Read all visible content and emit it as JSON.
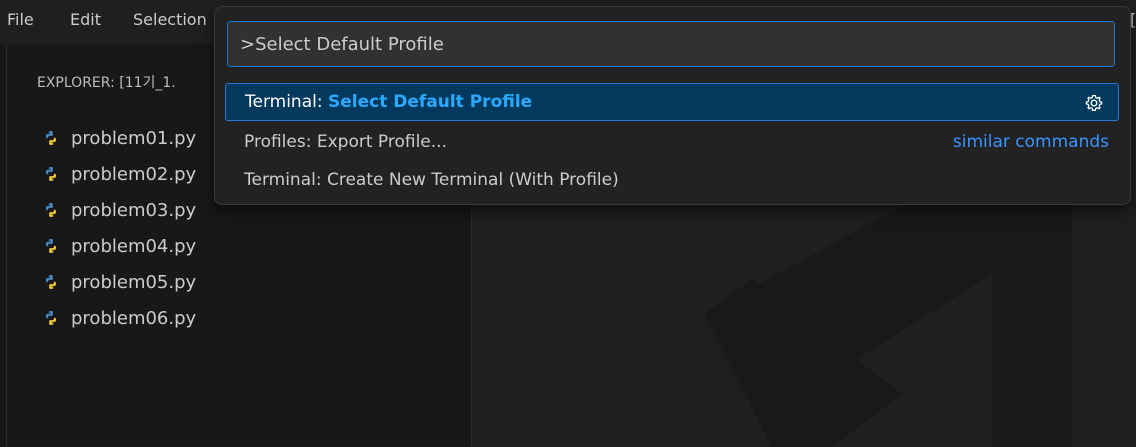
{
  "menubar": {
    "items": [
      "File",
      "Edit",
      "Selection"
    ],
    "right_edge_glyph": "["
  },
  "sidebar": {
    "title": "EXPLORER: [11기_1.",
    "files": [
      {
        "name": "problem01.py",
        "icon": "python-icon"
      },
      {
        "name": "problem02.py",
        "icon": "python-icon"
      },
      {
        "name": "problem03.py",
        "icon": "python-icon"
      },
      {
        "name": "problem04.py",
        "icon": "python-icon"
      },
      {
        "name": "problem05.py",
        "icon": "python-icon"
      },
      {
        "name": "problem06.py",
        "icon": "python-icon"
      }
    ]
  },
  "command_palette": {
    "input_value": ">Select Default Profile",
    "results": [
      {
        "prefix": "Terminal: ",
        "highlight": "Select Default Profile",
        "selected": true,
        "action_icon": "gear-icon"
      },
      {
        "prefix": "Profiles: Export Profile...",
        "highlight": "",
        "selected": false,
        "hint": "similar commands"
      },
      {
        "prefix": "Terminal: Create New Terminal (With Profile)",
        "highlight": "",
        "selected": false
      }
    ]
  },
  "colors": {
    "accent": "#0078d4",
    "highlight_text": "#2aaaff",
    "hint_link": "#3794ff",
    "selection_bg": "#04395e",
    "python_icon_blue": "#4a8cc6",
    "python_icon_yellow": "#f0c93a"
  }
}
